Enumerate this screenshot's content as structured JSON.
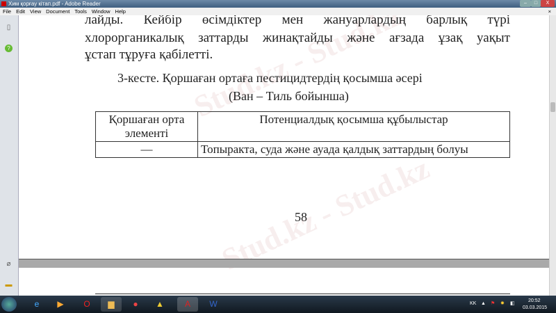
{
  "window": {
    "title": "Хим қорғау кітап.pdf - Adobe Reader",
    "minimize": "–",
    "maximize": "□",
    "close": "X"
  },
  "menu": [
    "File",
    "Edit",
    "View",
    "Document",
    "Tools",
    "Window",
    "Help"
  ],
  "menu_close": "×",
  "document": {
    "lines": [
      "лайды. Кейбір өсімдіктер мен жануарлардың барлық түрі",
      "хлорорганикалық заттарды жинақтайды және ағзада ұзақ уақыт",
      "ұстап тұруға қабілетті."
    ],
    "caption1": "3-кесте.  Қоршаған ортаға пестицидтердің қосымша әсері",
    "caption2": "(Ван – Тиль бойынша)",
    "table": {
      "headers": [
        "Қоршаған орта элементі",
        "Потенциалдық қосымша құбылыстар"
      ],
      "rows": [
        [
          "—",
          "Топыракта, суда және ауада қалдық заттардың болуы"
        ]
      ]
    },
    "page_number": "58",
    "watermark": "Stud.kz - Stud.kz"
  },
  "tray": {
    "lang": "KK",
    "time": "20:52",
    "date": "03.03.2015"
  }
}
